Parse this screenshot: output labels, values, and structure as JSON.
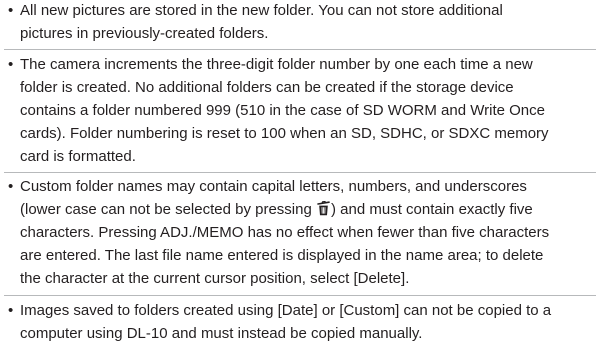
{
  "bullets": [
    {
      "lines": [
        "All new pictures are stored in the new folder. You can not store additional",
        "pictures in previously-created folders."
      ]
    },
    {
      "lines": [
        "The camera increments the three-digit folder number by one each time a new",
        "folder is created. No additional folders can be created if the storage device",
        "contains a folder numbered 999 (510 in the case of SD WORM and Write Once",
        "cards). Folder numbering is reset to 100 when an SD, SDHC, or SDXC memory",
        "card is formatted."
      ]
    },
    {
      "lines": [
        "Custom folder names may contain capital letters, numbers, and underscores",
        "characters. Pressing ADJ./MEMO has no effect when fewer than five characters",
        "are entered. The last file name entered is displayed in the name area; to delete",
        "the character at the current cursor position, select [Delete]."
      ],
      "inline_line": {
        "before": "(lower case can not be selected by pressing ",
        "icon": "trash-icon",
        "after": ") and must contain exactly five"
      }
    },
    {
      "lines": [
        "Images saved to folders created using [Date] or [Custom] can not be copied to a",
        "computer using DL-10 and must instead be copied manually."
      ]
    }
  ],
  "bullet_glyph": "•"
}
